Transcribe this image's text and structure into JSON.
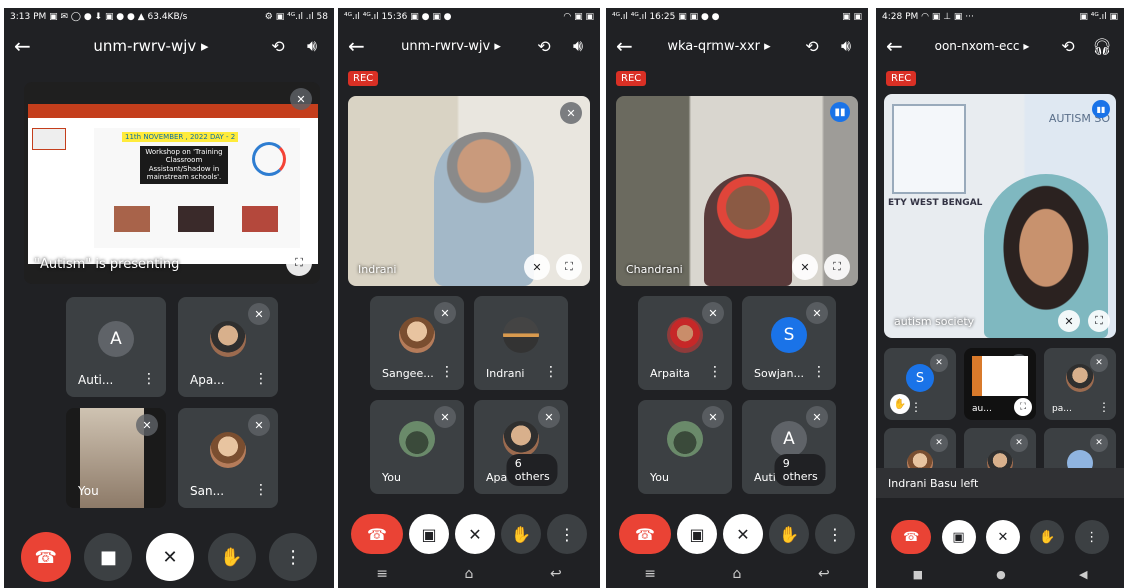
{
  "phone1": {
    "status_left": "3:13 PM ▣ ✉ ◯ ● ⬇ ▣ ● ● ▲ 63.4KB/s",
    "status_right": "⚙ ▣ ⁴ᴳ.ıl .ıl 58",
    "meeting_code": "unm-rwrv-wjv ▸",
    "presenting_label": "\"Autism\" is presenting",
    "slide": {
      "date_line": "11th NOVEMBER , 2022 DAY - 2",
      "workshop_title": "Workshop on 'Training Classroom Assistant/Shadow in mainstream schools'."
    },
    "tiles": [
      {
        "name": "Auti...",
        "avatar": "A"
      },
      {
        "name": "Apa..."
      },
      {
        "name": "You"
      },
      {
        "name": "San..."
      }
    ]
  },
  "phone2": {
    "status_left": "⁴ᴳ.ıl ⁴ᴳ.ıl 15:36 ▣ ● ▣ ●",
    "status_right": "◠ ▣ ▣",
    "rec": "REC",
    "meeting_code": "unm-rwrv-wjv ▸",
    "main_name": "Indrani",
    "tiles": [
      {
        "name": "Sangee..."
      },
      {
        "name": "Indrani"
      },
      {
        "name": "You"
      },
      {
        "name": "Apa"
      }
    ],
    "others": "6 others"
  },
  "phone3": {
    "status_left": "⁴ᴳ.ıl ⁴ᴳ.ıl 16:25 ▣ ▣ ● ●",
    "status_right": "▣ ▣",
    "rec": "REC",
    "meeting_code": "wka-qrmw-xxr ▸",
    "main_name": "Chandrani",
    "tiles": [
      {
        "name": "Arpaita"
      },
      {
        "name": "Sowjan...",
        "avatar": "S"
      },
      {
        "name": "You"
      },
      {
        "name": "Auti",
        "avatar": "A"
      }
    ],
    "others": "9 others"
  },
  "phone4": {
    "status_left": "4:28 PM ◠ ▣ ⊥ ▣ ···",
    "status_right": "▣ ⁴ᴳ.ıl ▣",
    "rec": "REC",
    "meeting_code": "oon-nxom-ecc ▸",
    "main_name": "autism society",
    "poster_text": "AUTISM SO",
    "poster_text2": "ETY WEST BENGAL",
    "tiles": [
      {
        "name": "",
        "avatar": "S"
      },
      {
        "name": "au..."
      },
      {
        "name": "pa..."
      }
    ],
    "toast": "Indrani Basu left"
  }
}
